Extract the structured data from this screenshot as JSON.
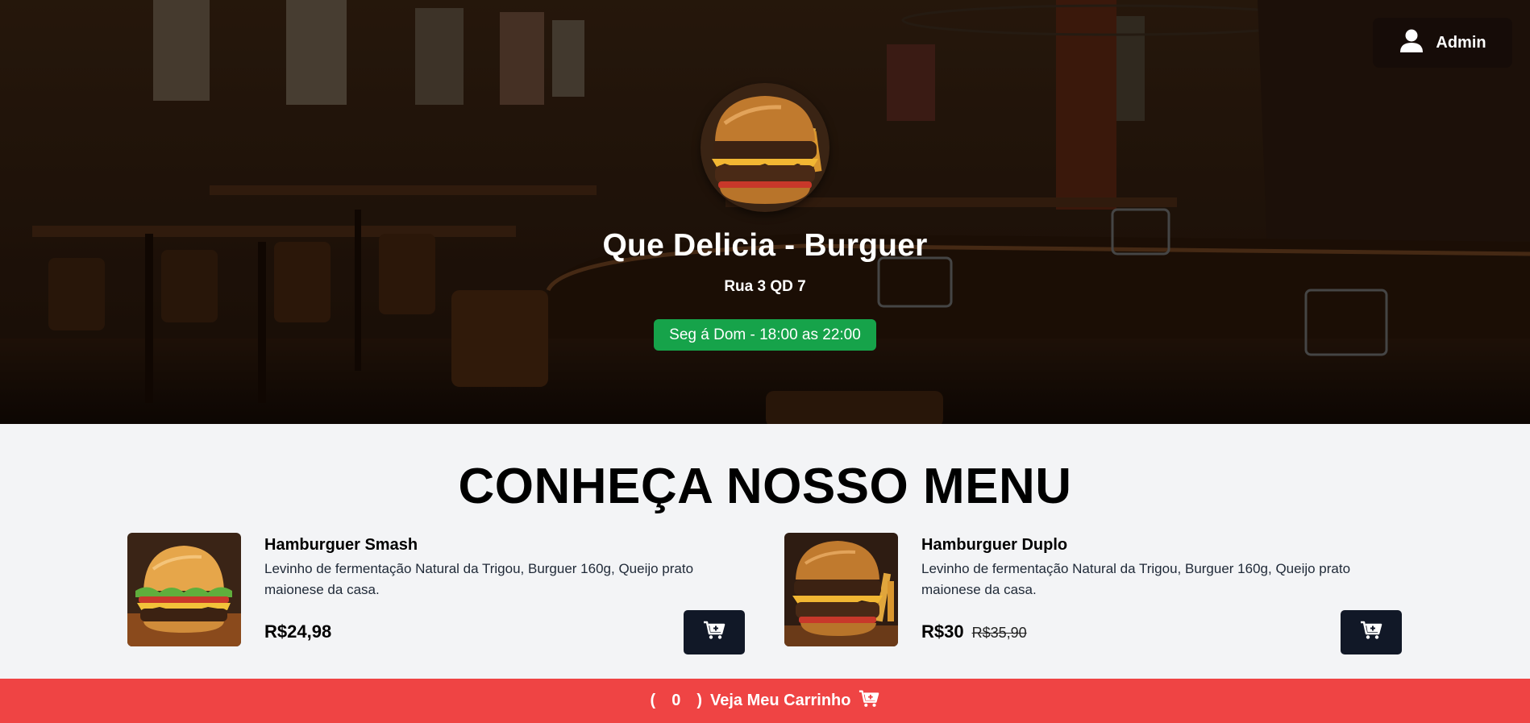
{
  "header": {
    "admin_label": "Admin",
    "restaurant_name": "Que Delicia - Burguer",
    "address": "Rua 3 QD 7",
    "hours": "Seg á Dom - 18:00 as 22:00"
  },
  "menu": {
    "title": "CONHEÇA NOSSO MENU",
    "items": [
      {
        "name": "Hamburguer Smash",
        "description": "Levinho de fermentação Natural da Trigou, Burguer 160g, Queijo prato maionese da casa.",
        "price": "R$24,98",
        "old_price": ""
      },
      {
        "name": "Hamburguer Duplo",
        "description": "Levinho de fermentação Natural da Trigou, Burguer 160g, Queijo prato maionese da casa.",
        "price": "R$30",
        "old_price": "R$35,90"
      }
    ]
  },
  "cart_bar": {
    "open_paren": "(",
    "count": "0",
    "close_paren": ")",
    "label": "Veja Meu Carrinho"
  },
  "colors": {
    "hours_badge": "#16a34a",
    "cart_bar": "#ef4444",
    "cart_button": "#111827"
  },
  "icons": {
    "admin": "user-icon",
    "cart": "cart-plus-icon"
  }
}
